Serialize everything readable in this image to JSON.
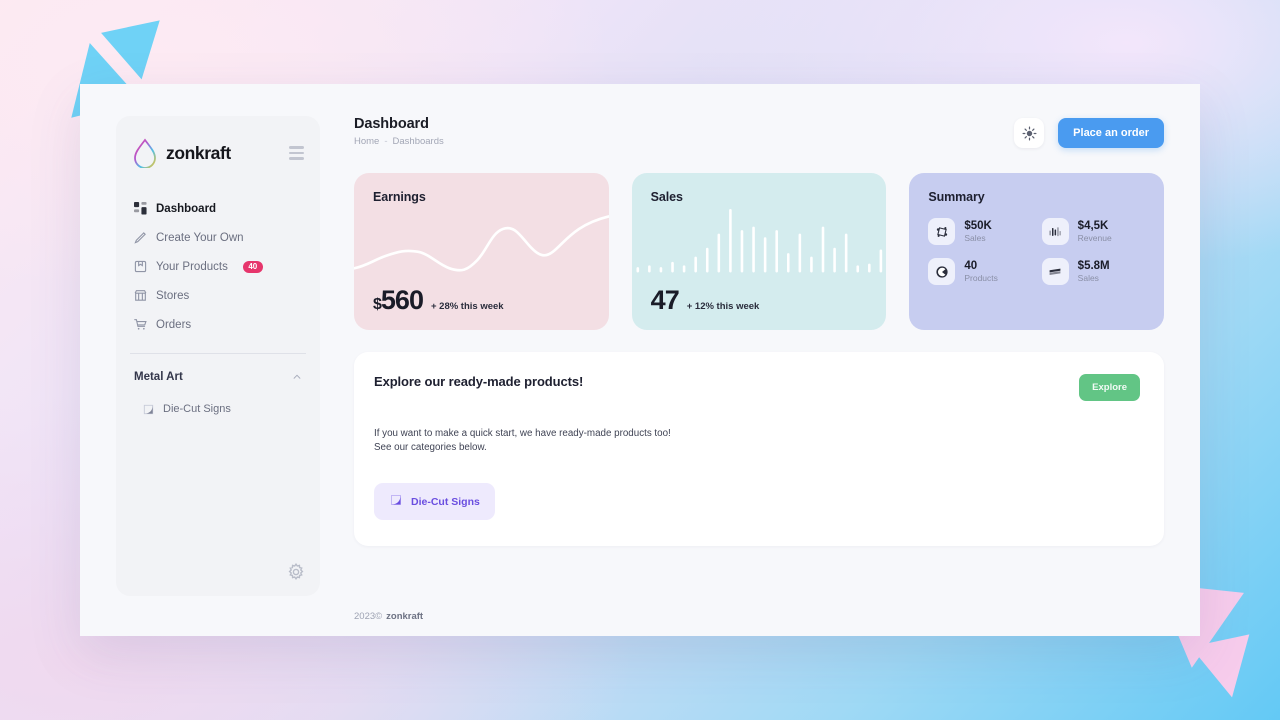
{
  "brand": {
    "name": "zonkraft",
    "logo_icon": "droplet-icon",
    "menu_icon": "hamburger-icon"
  },
  "sidebar": {
    "items": [
      {
        "label": "Dashboard",
        "icon": "grid-icon",
        "active": true,
        "badge": null
      },
      {
        "label": "Create Your Own",
        "icon": "pen-icon",
        "active": false,
        "badge": null
      },
      {
        "label": "Your Products",
        "icon": "package-icon",
        "active": false,
        "badge": "40"
      },
      {
        "label": "Stores",
        "icon": "store-icon",
        "active": false,
        "badge": null
      },
      {
        "label": "Orders",
        "icon": "cart-icon",
        "active": false,
        "badge": null
      }
    ],
    "group": {
      "title": "Metal Art",
      "collapse_icon": "chevron-up-icon",
      "items": [
        {
          "label": "Die-Cut Signs",
          "icon": "die-cut-icon"
        }
      ]
    },
    "settings_icon": "gear-icon"
  },
  "header": {
    "title": "Dashboard",
    "breadcrumb": [
      "Home",
      "Dashboards"
    ],
    "breadcrumb_separator": "-",
    "theme_icon": "sun-icon",
    "primary_button": "Place an order"
  },
  "cards": {
    "earnings": {
      "title": "Earnings",
      "currency": "$",
      "value": "560",
      "delta": "+ 28% this week",
      "bg": "#f3dfe4"
    },
    "sales": {
      "title": "Sales",
      "value": "47",
      "delta": "+ 12% this week",
      "bg": "#d4ecee"
    },
    "summary": {
      "title": "Summary",
      "bg": "#c7cdf0",
      "items": [
        {
          "value": "$50K",
          "label": "Sales",
          "icon": "transform-icon"
        },
        {
          "value": "$4,5K",
          "label": "Revenue",
          "icon": "bar-chart-icon"
        },
        {
          "value": "40",
          "label": "Products",
          "icon": "circle-c-icon"
        },
        {
          "value": "$5.8M",
          "label": "Sales",
          "icon": "layers-icon"
        }
      ]
    }
  },
  "explore": {
    "title": "Explore our ready-made products!",
    "button": "Explore",
    "description_line1": "If you want to make a quick start, we have ready-made products too!",
    "description_line2": "See our categories below.",
    "chips": [
      {
        "label": "Die-Cut Signs",
        "icon": "die-cut-icon"
      }
    ]
  },
  "footer": {
    "year": "2023©",
    "brand": "zonkraft"
  },
  "chart_data": [
    {
      "type": "line",
      "title": "Earnings",
      "x": [
        0,
        1,
        2,
        3,
        4,
        5,
        6,
        7,
        8,
        9,
        10,
        11,
        12
      ],
      "values": [
        22,
        30,
        37,
        34,
        26,
        24,
        30,
        52,
        62,
        50,
        40,
        52,
        70
      ],
      "ylim": [
        0,
        80
      ],
      "series_color": "#ffffff",
      "grid": false,
      "legend": "none"
    },
    {
      "type": "bar",
      "title": "Sales",
      "categories": [
        "1",
        "2",
        "3",
        "4",
        "5",
        "6",
        "7",
        "8",
        "9",
        "10",
        "11",
        "12",
        "13",
        "14",
        "15",
        "16",
        "17",
        "18",
        "19",
        "20",
        "21",
        "22"
      ],
      "values": [
        3,
        4,
        3,
        6,
        4,
        9,
        14,
        22,
        36,
        24,
        26,
        20,
        24,
        11,
        22,
        9,
        26,
        14,
        22,
        4,
        5,
        13
      ],
      "ylim": [
        0,
        40
      ],
      "series_color": "#ffffff",
      "grid": false,
      "legend": "none"
    }
  ]
}
